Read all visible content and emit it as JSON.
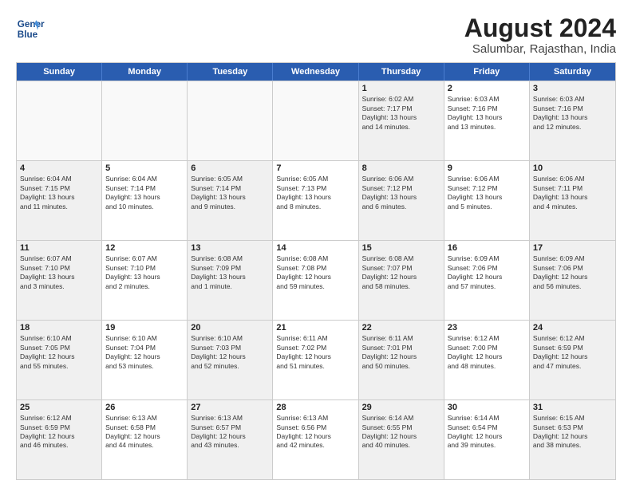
{
  "logo": {
    "line1": "General",
    "line2": "Blue"
  },
  "title": "August 2024",
  "subtitle": "Salumbar, Rajasthan, India",
  "header_days": [
    "Sunday",
    "Monday",
    "Tuesday",
    "Wednesday",
    "Thursday",
    "Friday",
    "Saturday"
  ],
  "weeks": [
    [
      {
        "day": "",
        "info": ""
      },
      {
        "day": "",
        "info": ""
      },
      {
        "day": "",
        "info": ""
      },
      {
        "day": "",
        "info": ""
      },
      {
        "day": "1",
        "info": "Sunrise: 6:02 AM\nSunset: 7:17 PM\nDaylight: 13 hours\nand 14 minutes."
      },
      {
        "day": "2",
        "info": "Sunrise: 6:03 AM\nSunset: 7:16 PM\nDaylight: 13 hours\nand 13 minutes."
      },
      {
        "day": "3",
        "info": "Sunrise: 6:03 AM\nSunset: 7:16 PM\nDaylight: 13 hours\nand 12 minutes."
      }
    ],
    [
      {
        "day": "4",
        "info": "Sunrise: 6:04 AM\nSunset: 7:15 PM\nDaylight: 13 hours\nand 11 minutes."
      },
      {
        "day": "5",
        "info": "Sunrise: 6:04 AM\nSunset: 7:14 PM\nDaylight: 13 hours\nand 10 minutes."
      },
      {
        "day": "6",
        "info": "Sunrise: 6:05 AM\nSunset: 7:14 PM\nDaylight: 13 hours\nand 9 minutes."
      },
      {
        "day": "7",
        "info": "Sunrise: 6:05 AM\nSunset: 7:13 PM\nDaylight: 13 hours\nand 8 minutes."
      },
      {
        "day": "8",
        "info": "Sunrise: 6:06 AM\nSunset: 7:12 PM\nDaylight: 13 hours\nand 6 minutes."
      },
      {
        "day": "9",
        "info": "Sunrise: 6:06 AM\nSunset: 7:12 PM\nDaylight: 13 hours\nand 5 minutes."
      },
      {
        "day": "10",
        "info": "Sunrise: 6:06 AM\nSunset: 7:11 PM\nDaylight: 13 hours\nand 4 minutes."
      }
    ],
    [
      {
        "day": "11",
        "info": "Sunrise: 6:07 AM\nSunset: 7:10 PM\nDaylight: 13 hours\nand 3 minutes."
      },
      {
        "day": "12",
        "info": "Sunrise: 6:07 AM\nSunset: 7:10 PM\nDaylight: 13 hours\nand 2 minutes."
      },
      {
        "day": "13",
        "info": "Sunrise: 6:08 AM\nSunset: 7:09 PM\nDaylight: 13 hours\nand 1 minute."
      },
      {
        "day": "14",
        "info": "Sunrise: 6:08 AM\nSunset: 7:08 PM\nDaylight: 12 hours\nand 59 minutes."
      },
      {
        "day": "15",
        "info": "Sunrise: 6:08 AM\nSunset: 7:07 PM\nDaylight: 12 hours\nand 58 minutes."
      },
      {
        "day": "16",
        "info": "Sunrise: 6:09 AM\nSunset: 7:06 PM\nDaylight: 12 hours\nand 57 minutes."
      },
      {
        "day": "17",
        "info": "Sunrise: 6:09 AM\nSunset: 7:06 PM\nDaylight: 12 hours\nand 56 minutes."
      }
    ],
    [
      {
        "day": "18",
        "info": "Sunrise: 6:10 AM\nSunset: 7:05 PM\nDaylight: 12 hours\nand 55 minutes."
      },
      {
        "day": "19",
        "info": "Sunrise: 6:10 AM\nSunset: 7:04 PM\nDaylight: 12 hours\nand 53 minutes."
      },
      {
        "day": "20",
        "info": "Sunrise: 6:10 AM\nSunset: 7:03 PM\nDaylight: 12 hours\nand 52 minutes."
      },
      {
        "day": "21",
        "info": "Sunrise: 6:11 AM\nSunset: 7:02 PM\nDaylight: 12 hours\nand 51 minutes."
      },
      {
        "day": "22",
        "info": "Sunrise: 6:11 AM\nSunset: 7:01 PM\nDaylight: 12 hours\nand 50 minutes."
      },
      {
        "day": "23",
        "info": "Sunrise: 6:12 AM\nSunset: 7:00 PM\nDaylight: 12 hours\nand 48 minutes."
      },
      {
        "day": "24",
        "info": "Sunrise: 6:12 AM\nSunset: 6:59 PM\nDaylight: 12 hours\nand 47 minutes."
      }
    ],
    [
      {
        "day": "25",
        "info": "Sunrise: 6:12 AM\nSunset: 6:59 PM\nDaylight: 12 hours\nand 46 minutes."
      },
      {
        "day": "26",
        "info": "Sunrise: 6:13 AM\nSunset: 6:58 PM\nDaylight: 12 hours\nand 44 minutes."
      },
      {
        "day": "27",
        "info": "Sunrise: 6:13 AM\nSunset: 6:57 PM\nDaylight: 12 hours\nand 43 minutes."
      },
      {
        "day": "28",
        "info": "Sunrise: 6:13 AM\nSunset: 6:56 PM\nDaylight: 12 hours\nand 42 minutes."
      },
      {
        "day": "29",
        "info": "Sunrise: 6:14 AM\nSunset: 6:55 PM\nDaylight: 12 hours\nand 40 minutes."
      },
      {
        "day": "30",
        "info": "Sunrise: 6:14 AM\nSunset: 6:54 PM\nDaylight: 12 hours\nand 39 minutes."
      },
      {
        "day": "31",
        "info": "Sunrise: 6:15 AM\nSunset: 6:53 PM\nDaylight: 12 hours\nand 38 minutes."
      }
    ]
  ]
}
